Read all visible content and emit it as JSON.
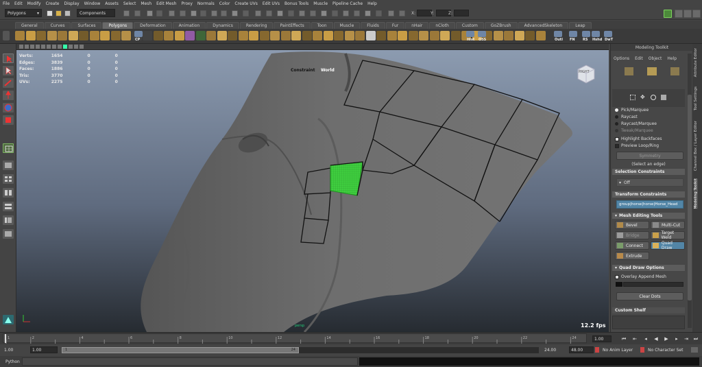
{
  "menubar": [
    "File",
    "Edit",
    "Modify",
    "Create",
    "Display",
    "Window",
    "Assets",
    "Select",
    "Mesh",
    "Edit Mesh",
    "Proxy",
    "Normals",
    "Color",
    "Create UVs",
    "Edit UVs",
    "Bonus Tools",
    "Muscle",
    "Pipeline Cache",
    "Help"
  ],
  "status": {
    "menu_set": "Polygons",
    "selection_mode": "Components",
    "x_label": "X:",
    "y_label": "Y:",
    "z_label": "Z:"
  },
  "shelf_tabs": [
    "General",
    "Curves",
    "Surfaces",
    "Polygons",
    "Deformation",
    "Animation",
    "Dynamics",
    "Rendering",
    "PaintEffects",
    "Toon",
    "Muscle",
    "Fluids",
    "Fur",
    "nHair",
    "nCloth",
    "Custom",
    "GoZBrush",
    "AdvancedSkeleton",
    "Leap"
  ],
  "shelf_active": "Polygons",
  "shelf_labels": {
    "cp": "CP",
    "hist": "Hist",
    "oss": "OSS",
    "outl": "Outl",
    "fn": "FN",
    "rs": "RS",
    "hshd": "Hshd",
    "dwt": "DwT"
  },
  "hud": {
    "rows": [
      {
        "label": "Verts:",
        "v1": "1654",
        "v2": "0",
        "v3": "0"
      },
      {
        "label": "Edges:",
        "v1": "3839",
        "v2": "0",
        "v3": "0"
      },
      {
        "label": "Faces:",
        "v1": "1886",
        "v2": "0",
        "v3": "0"
      },
      {
        "label": "Tris:",
        "v1": "3770",
        "v2": "0",
        "v3": "0"
      },
      {
        "label": "UVs:",
        "v1": "2275",
        "v2": "0",
        "v3": "0"
      }
    ],
    "constraint_label": "Constraint",
    "world_label": "World",
    "fps": "12.2 fps",
    "viewcube": "RIGHT",
    "camera": "persp"
  },
  "panel": {
    "title": "Modeling Toolkit",
    "menu": [
      "Options",
      "Edit",
      "Object",
      "Help"
    ],
    "select_modes": [
      {
        "label": "Pick/Marquee",
        "checked": true
      },
      {
        "label": "Raycast",
        "checked": false
      },
      {
        "label": "Raycast/Marquee",
        "checked": false
      },
      {
        "label": "Tweak/Marquee",
        "checked": false
      }
    ],
    "highlight_backfaces": "Highlight Backfaces",
    "preview_loop": "Preview Loop/Ring",
    "symmetry": "Symmetry",
    "select_edge": "(Select an edge)",
    "selection_constraints": "Selection Constraints",
    "off": "Off",
    "transform_constraints": "Transform Constraints",
    "transform_target": "group|horse|horse|Horse_Head",
    "mesh_editing": "Mesh Editing Tools",
    "tools": [
      {
        "label": "Bevel",
        "sel": false
      },
      {
        "label": "Multi-Cut",
        "sel": false
      },
      {
        "label": "Bridge",
        "sel": false
      },
      {
        "label": "Target Weld",
        "sel": false
      },
      {
        "label": "Connect",
        "sel": false
      },
      {
        "label": "Quad Draw",
        "sel": true
      },
      {
        "label": "Extrude",
        "sel": false
      }
    ],
    "quad_draw_options": "Quad Draw Options",
    "overlay_append": "Overlay Append Mesh",
    "clear_dots": "Clear Dots",
    "custom_shelf": "Custom Shelf",
    "side_tabs": [
      "Attribute Editor",
      "Tool Settings",
      "Channel Box / Layer Editor",
      "Modeling Toolkit"
    ]
  },
  "timeline": {
    "ticks": [
      "1",
      "2",
      "4",
      "6",
      "8",
      "10",
      "12",
      "14",
      "16",
      "18",
      "20",
      "22",
      "24"
    ],
    "current": "1.00"
  },
  "range": {
    "start": "1.00",
    "start2": "1.00",
    "slider_start": "1",
    "slider_end": "24",
    "end": "24.00",
    "end2": "48.00",
    "anim_layer": "No Anim Layer",
    "char_set": "No Character Set"
  },
  "cmdline": {
    "label": "Python"
  },
  "colors": {
    "accent": "#5285a6",
    "quad_face": "#4be04b",
    "viewport_top": "#8c9bb0",
    "viewport_bottom": "#262b31"
  }
}
